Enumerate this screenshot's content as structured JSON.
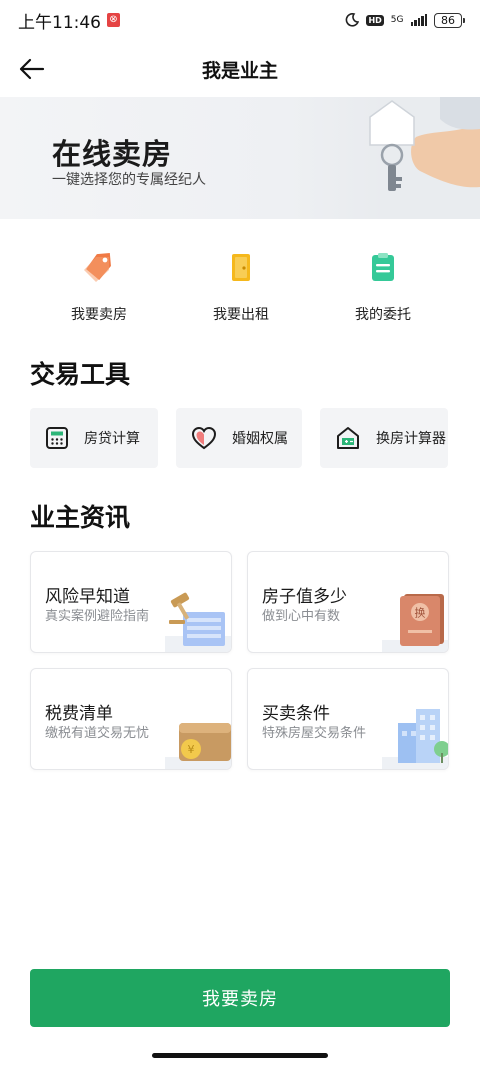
{
  "status_bar": {
    "time": "上午11:46",
    "network": "5G",
    "hd": "HD",
    "battery": "86"
  },
  "nav": {
    "title": "我是业主"
  },
  "banner": {
    "title": "在线卖房",
    "subtitle": "一键选择您的专属经纪人"
  },
  "quick_actions": [
    {
      "label": "我要卖房",
      "icon": "tag-icon",
      "color": "#f07a45"
    },
    {
      "label": "我要出租",
      "icon": "door-icon",
      "color": "#f5b81c"
    },
    {
      "label": "我的委托",
      "icon": "clipboard-icon",
      "color": "#35c998"
    }
  ],
  "tools": {
    "title": "交易工具",
    "items": [
      {
        "label": "房贷计算",
        "icon": "calculator-icon"
      },
      {
        "label": "婚姻权属",
        "icon": "heart-icon"
      },
      {
        "label": "换房计算器",
        "icon": "house-calc-icon"
      }
    ]
  },
  "info": {
    "title": "业主资讯",
    "cards": [
      {
        "title": "风险早知道",
        "subtitle": "真实案例避险指南",
        "icon": "gavel-icon"
      },
      {
        "title": "房子值多少",
        "subtitle": "做到心中有数",
        "icon": "certificate-icon",
        "badge": "换"
      },
      {
        "title": "税费清单",
        "subtitle": "缴税有道交易无忧",
        "icon": "wallet-icon"
      },
      {
        "title": "买卖条件",
        "subtitle": "特殊房屋交易条件",
        "icon": "building-icon"
      }
    ]
  },
  "cta": {
    "label": "我要卖房",
    "color": "#1fa661"
  }
}
